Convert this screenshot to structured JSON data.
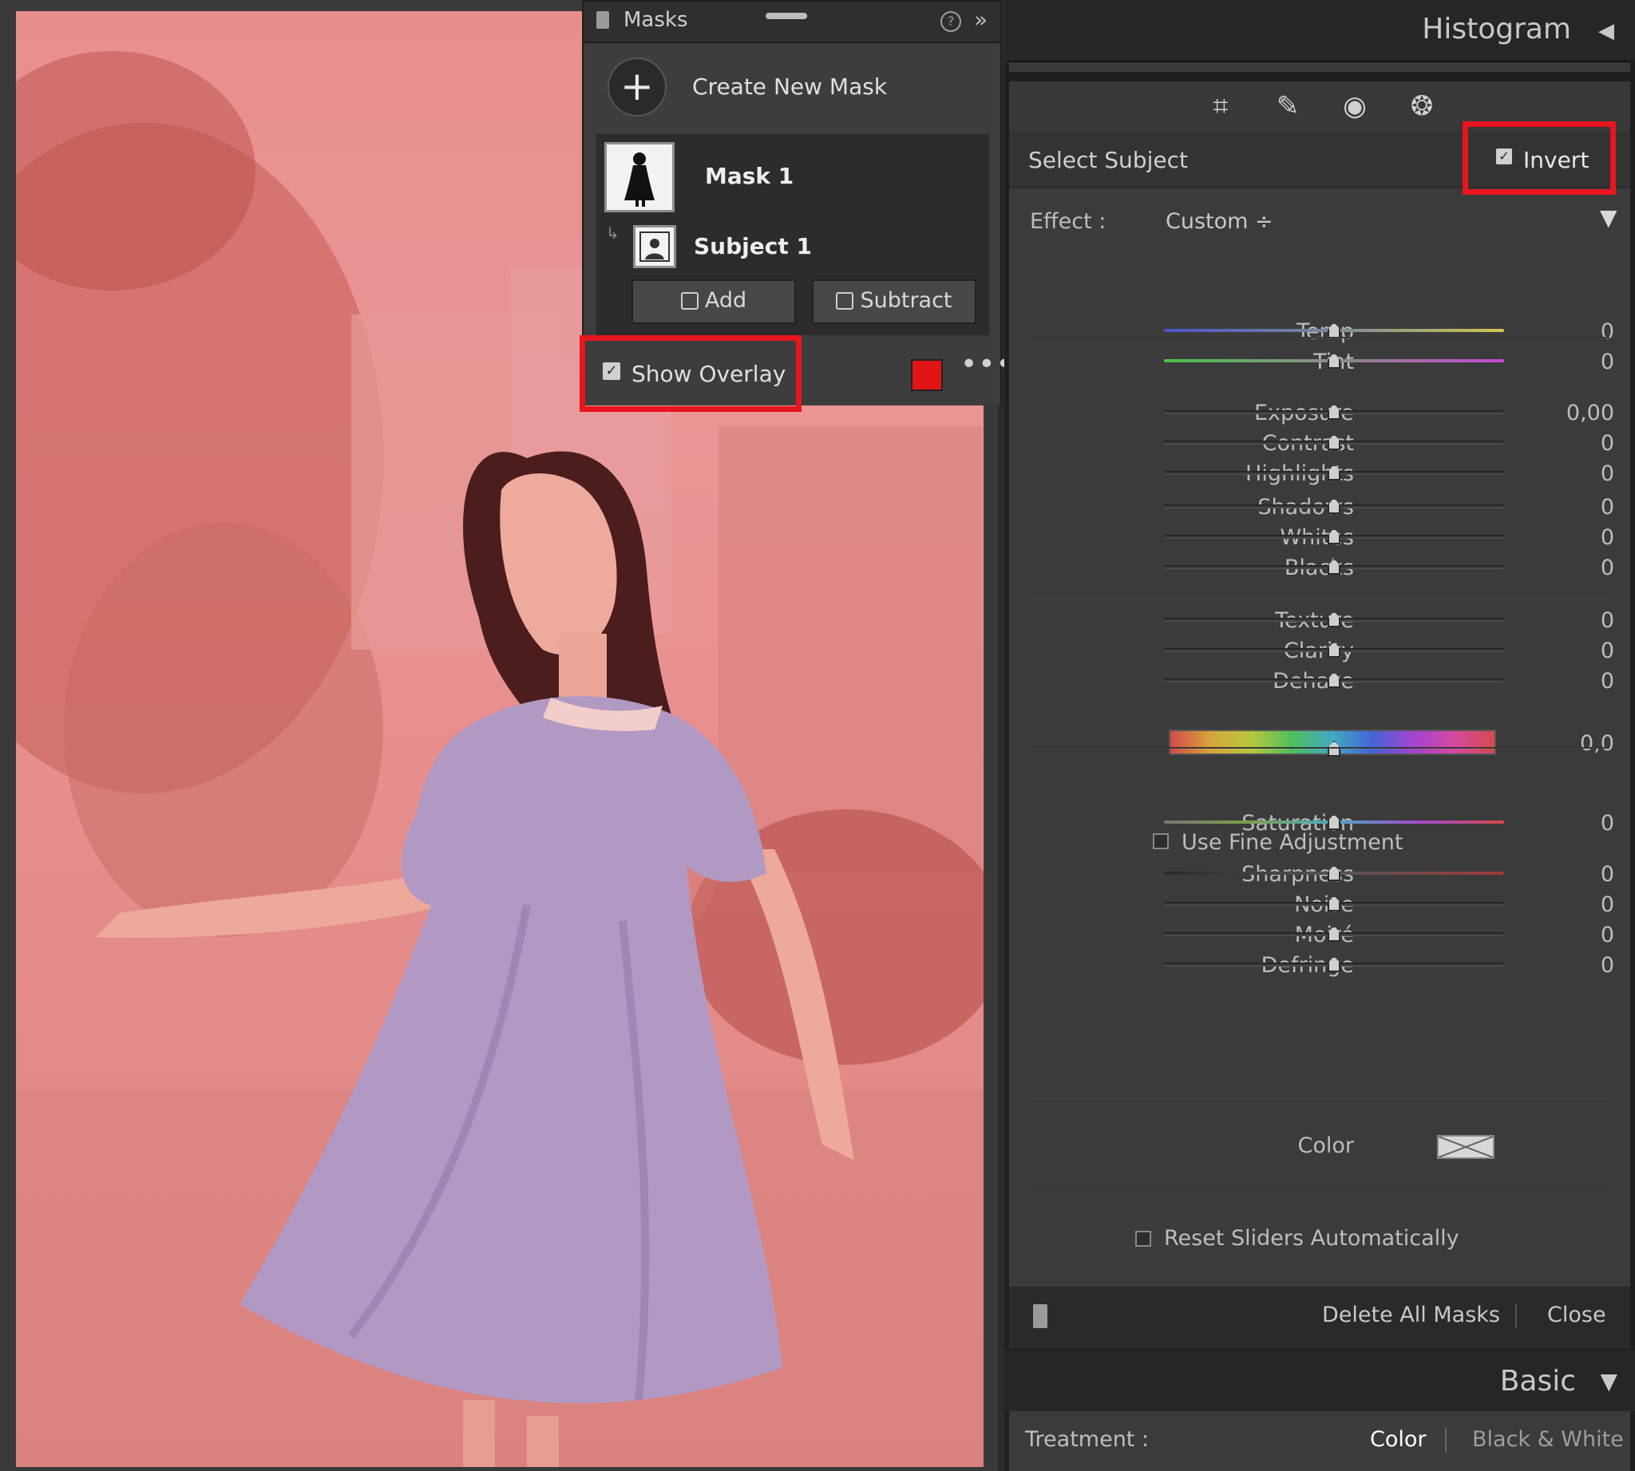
{
  "masks_panel": {
    "title": "Masks",
    "create_label": "Create New Mask",
    "mask_name": "Mask 1",
    "component_name": "Subject 1",
    "add_label": "Add",
    "subtract_label": "Subtract",
    "show_overlay_label": "Show Overlay",
    "show_overlay_checked": true,
    "overlay_color": "#e01414",
    "help_symbol": "?",
    "expand_symbol": "»",
    "more_symbol": "•••",
    "plus_symbol": "+"
  },
  "right_panel": {
    "histogram_title": "Histogram",
    "tools": [
      "crop-icon",
      "healing-icon",
      "red-eye-icon",
      "masking-icon"
    ],
    "select_subject_label": "Select Subject",
    "invert_label": "Invert",
    "invert_checked": true,
    "effect_label": "Effect :",
    "effect_value": "Custom ÷",
    "sliders": [
      {
        "label": "Temp",
        "value": "0",
        "position": 0.5
      },
      {
        "label": "Tint",
        "value": "0",
        "position": 0.5
      },
      {
        "label": "Exposure",
        "value": "0,00",
        "position": 0.5
      },
      {
        "label": "Contrast",
        "value": "0",
        "position": 0.5
      },
      {
        "label": "Highlights",
        "value": "0",
        "position": 0.5
      },
      {
        "label": "Shadows",
        "value": "0",
        "position": 0.5
      },
      {
        "label": "Whites",
        "value": "0",
        "position": 0.5
      },
      {
        "label": "Blacks",
        "value": "0",
        "position": 0.5
      },
      {
        "label": "Texture",
        "value": "0",
        "position": 0.5
      },
      {
        "label": "Clarity",
        "value": "0",
        "position": 0.5
      },
      {
        "label": "Dehaze",
        "value": "0",
        "position": 0.5
      },
      {
        "label": "Hue",
        "value": "0,0",
        "position": 0.5
      },
      {
        "label": "Saturation",
        "value": "0",
        "position": 0.5
      },
      {
        "label": "Sharpness",
        "value": "0",
        "position": 0.5
      },
      {
        "label": "Noise",
        "value": "0",
        "position": 0.5
      },
      {
        "label": "Moiré",
        "value": "0",
        "position": 0.5
      },
      {
        "label": "Defringe",
        "value": "0",
        "position": 0.5
      }
    ],
    "fine_adjustment_label": "Use Fine Adjustment",
    "color_label": "Color",
    "reset_sliders_label": "Reset Sliders Automatically",
    "delete_all_label": "Delete All Masks",
    "close_label": "Close",
    "basic_title": "Basic",
    "treatment_label": "Treatment :",
    "treatment_color": "Color",
    "treatment_bw": "Black & White"
  },
  "colors": {
    "highlight_box": "#e8141e",
    "panel_bg": "#3b3b3b",
    "accent": "#e01414"
  }
}
